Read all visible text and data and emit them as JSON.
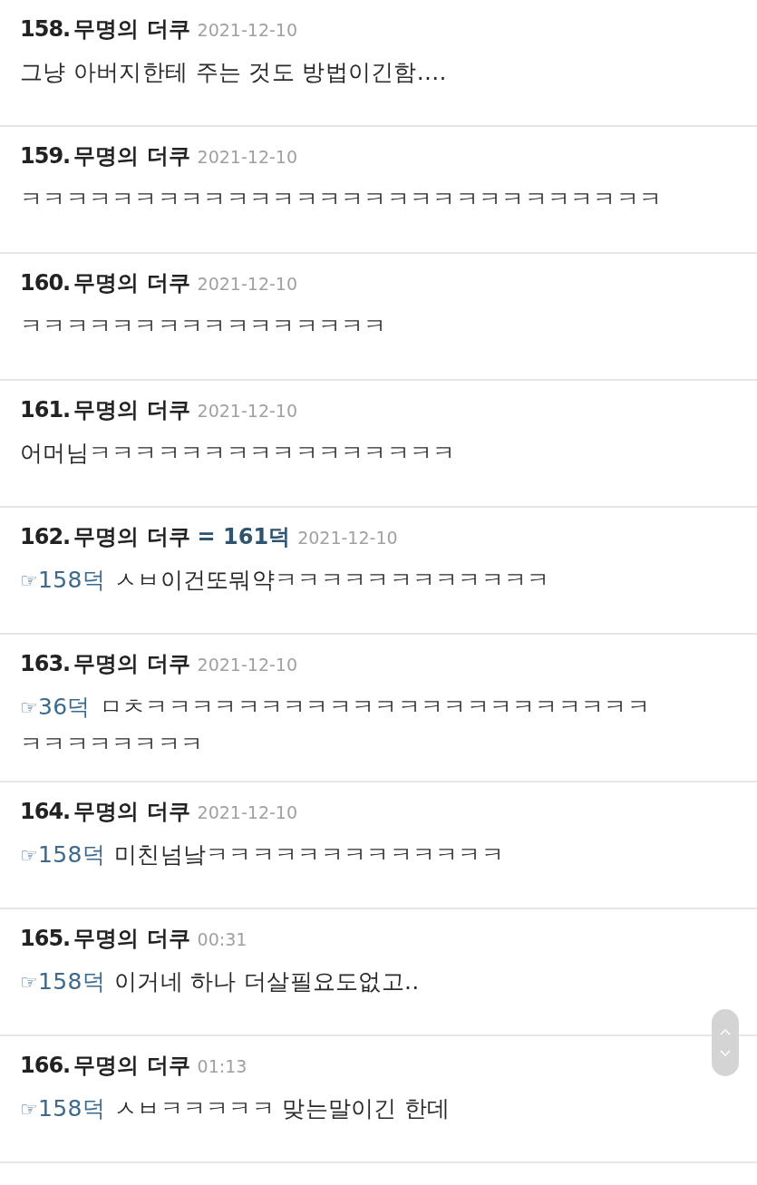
{
  "comments": [
    {
      "number": "158.",
      "author": "무명의 더쿠",
      "date": "2021-12-10",
      "body": "그냥 아버지한테 주는 것도 방법이긴함...."
    },
    {
      "number": "159.",
      "author": "무명의 더쿠",
      "date": "2021-12-10",
      "body": "ㅋㅋㅋㅋㅋㅋㅋㅋㅋㅋㅋㅋㅋㅋㅋㅋㅋㅋㅋㅋㅋㅋㅋㅋㅋㅋㅋㅋ"
    },
    {
      "number": "160.",
      "author": "무명의 더쿠",
      "date": "2021-12-10",
      "body": "ㅋㅋㅋㅋㅋㅋㅋㅋㅋㅋㅋㅋㅋㅋㅋㅋ"
    },
    {
      "number": "161.",
      "author": "무명의 더쿠",
      "date": "2021-12-10",
      "body": "어머님ㅋㅋㅋㅋㅋㅋㅋㅋㅋㅋㅋㅋㅋㅋㅋㅋ"
    },
    {
      "number": "162.",
      "author": "무명의 더쿠",
      "same_as": "= 161덕",
      "date": "2021-12-10",
      "pointer": "☞",
      "reply_to": "158덕",
      "body": "ㅅㅂ이건또뭐약ㅋㅋㅋㅋㅋㅋㅋㅋㅋㅋㅋㅋ"
    },
    {
      "number": "163.",
      "author": "무명의 더쿠",
      "date": "2021-12-10",
      "pointer": "☞",
      "reply_to": "36덕",
      "body": "ㅁㅊㅋㅋㅋㅋㅋㅋㅋㅋㅋㅋㅋㅋㅋㅋㅋㅋㅋㅋㅋㅋㅋㅋ",
      "continuation": "ㅋㅋㅋㅋㅋㅋㅋㅋ"
    },
    {
      "number": "164.",
      "author": "무명의 더쿠",
      "date": "2021-12-10",
      "pointer": "☞",
      "reply_to": "158덕",
      "body": "미친넘낰ㅋㅋㅋㅋㅋㅋㅋㅋㅋㅋㅋㅋㅋ"
    },
    {
      "number": "165.",
      "author": "무명의 더쿠",
      "date": "00:31",
      "pointer": "☞",
      "reply_to": "158덕",
      "body": "이거네 하나 더살필요도없고.."
    },
    {
      "number": "166.",
      "author": "무명의 더쿠",
      "date": "01:13",
      "pointer": "☞",
      "reply_to": "158덕",
      "body": "ㅅㅂㅋㅋㅋㅋㅋ 맞는말이긴 한데"
    }
  ]
}
